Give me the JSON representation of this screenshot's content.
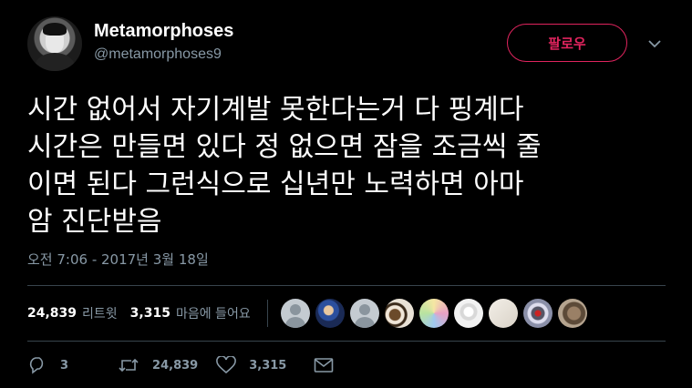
{
  "author": {
    "name": "Metamorphoses",
    "handle": "@metamorphoses9"
  },
  "follow_label": "팔로우",
  "tweet": {
    "text": "시간 없어서 자기계발 못한다는거 다 핑계다\n시간은 만들면 있다 정 없으면 잠을 조금씩 줄\n이면 된다 그런식으로 십년만 노력하면 아마\n암 진단받음",
    "timestamp": "오전 7:06 - 2017년 3월 18일"
  },
  "stats": {
    "retweets": "24,839",
    "retweets_label": "리트윗",
    "likes": "3,315",
    "likes_label": "마음에 들어요"
  },
  "liker_avatars": [
    "default-avatar",
    "photo-blue",
    "default-avatar",
    "photo-cats",
    "photo-colorful",
    "photo-figure",
    "photo-light",
    "photo-tower",
    "photo-cat"
  ],
  "actions": {
    "replies": "3",
    "retweets": "24,839",
    "likes": "3,315"
  },
  "colors": {
    "accent": "#e0245e",
    "secondary_text": "#8899a6",
    "background": "#000000",
    "divider": "#38444d"
  }
}
